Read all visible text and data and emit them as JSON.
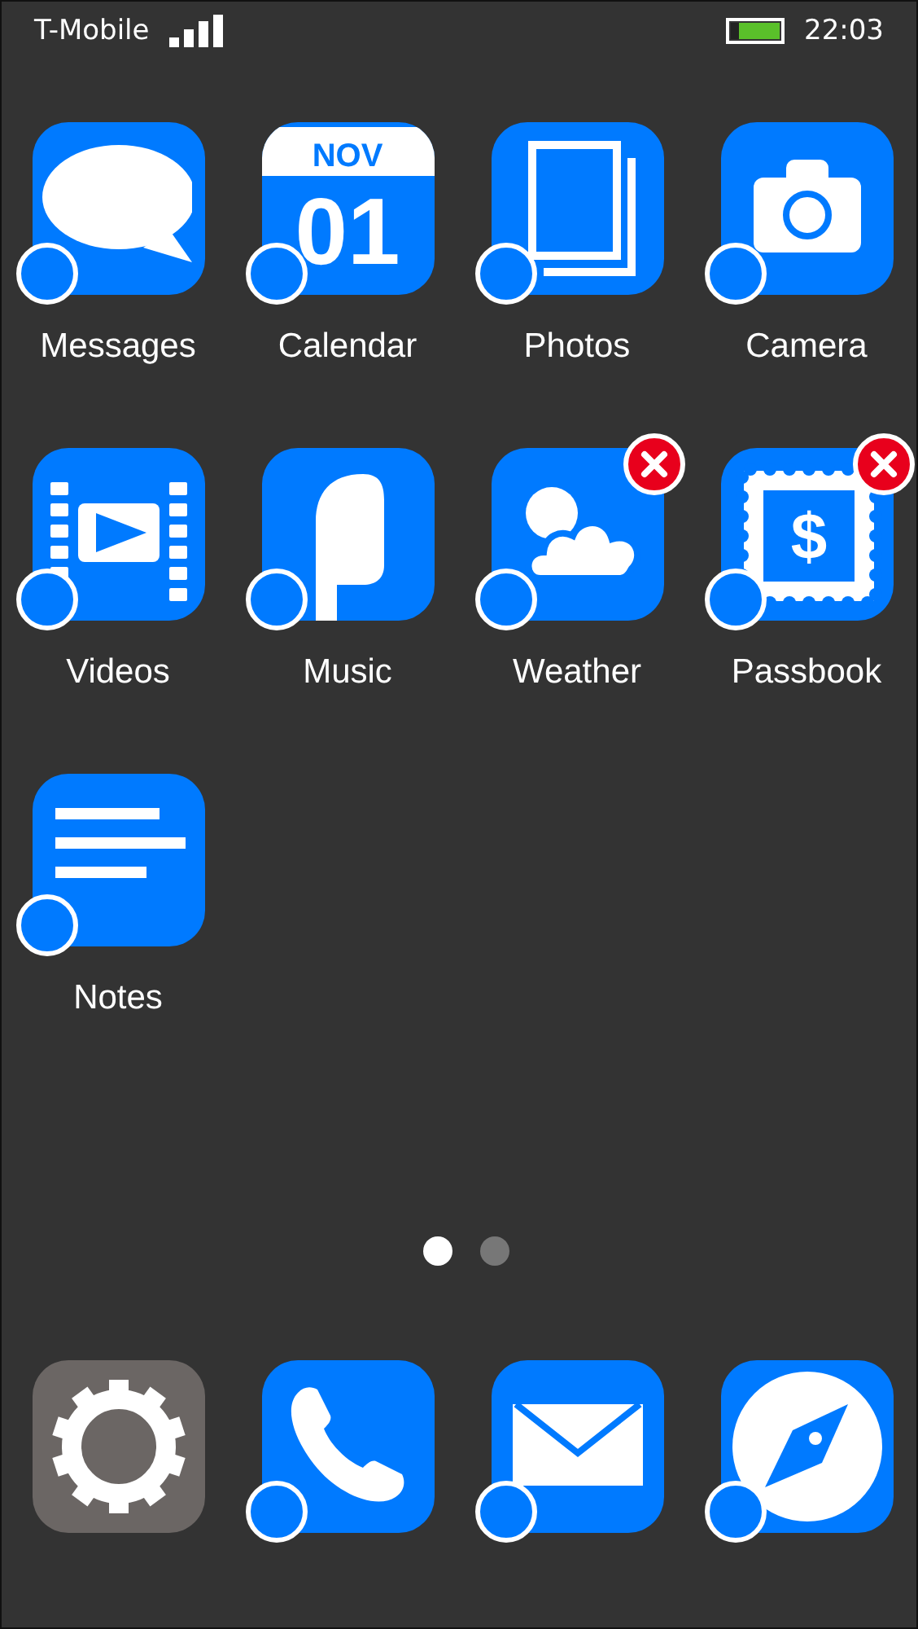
{
  "status_bar": {
    "carrier": "T-Mobile",
    "time": "22:03"
  },
  "apps": [
    {
      "kind": "messages",
      "label": "Messages",
      "marker": true,
      "removable": false
    },
    {
      "kind": "calendar",
      "label": "Calendar",
      "month": "NOV",
      "day": "01",
      "marker": true,
      "removable": false
    },
    {
      "kind": "photos",
      "label": "Photos",
      "marker": true,
      "removable": false
    },
    {
      "kind": "camera",
      "label": "Camera",
      "marker": true,
      "removable": false
    },
    {
      "kind": "videos",
      "label": "Videos",
      "marker": true,
      "removable": false
    },
    {
      "kind": "music",
      "label": "Music",
      "marker": true,
      "removable": false
    },
    {
      "kind": "weather",
      "label": "Weather",
      "marker": true,
      "removable": true
    },
    {
      "kind": "passbook",
      "label": "Passbook",
      "symbol": "$",
      "marker": true,
      "removable": true
    },
    {
      "kind": "notes",
      "label": "Notes",
      "marker": true,
      "removable": false
    }
  ],
  "page_dots": [
    {
      "selected": true
    },
    {
      "selected": false
    }
  ],
  "dock": [
    {
      "kind": "settings",
      "marker": false,
      "removable": false
    },
    {
      "kind": "phone",
      "marker": true,
      "removable": false
    },
    {
      "kind": "mail",
      "marker": true,
      "removable": false
    },
    {
      "kind": "compass",
      "marker": true,
      "removable": false
    }
  ]
}
